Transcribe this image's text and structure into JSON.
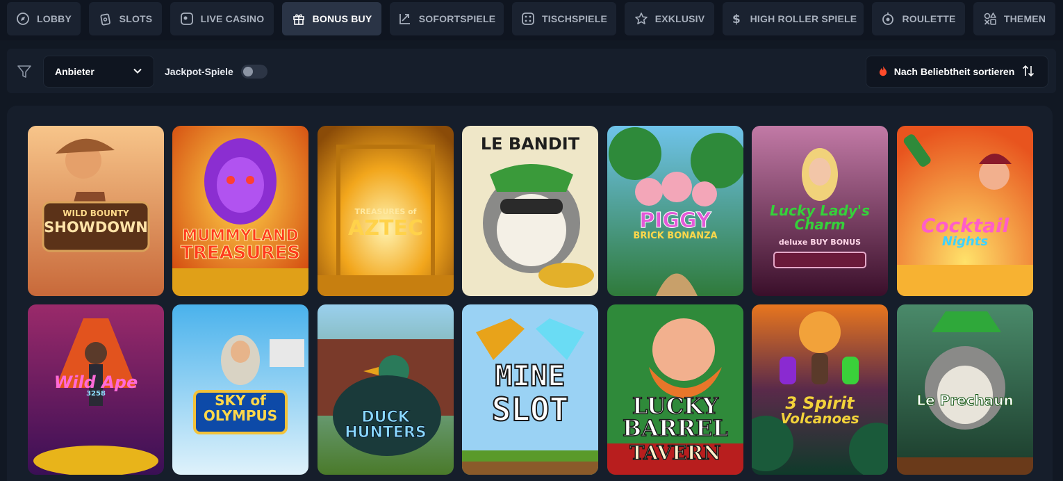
{
  "nav": {
    "items": [
      {
        "label": "LOBBY",
        "icon": "compass-icon",
        "active": false
      },
      {
        "label": "SLOTS",
        "icon": "slot-cards-icon",
        "active": false
      },
      {
        "label": "LIVE CASINO",
        "icon": "live-screen-icon",
        "active": false
      },
      {
        "label": "BONUS BUY",
        "icon": "gift-icon",
        "active": true
      },
      {
        "label": "SOFORTSPIELE",
        "icon": "chart-arrow-icon",
        "active": false
      },
      {
        "label": "TISCHSPIELE",
        "icon": "dice-icon",
        "active": false
      },
      {
        "label": "EXKLUSIV",
        "icon": "star-icon",
        "active": false
      },
      {
        "label": "HIGH ROLLER SPIELE",
        "icon": "dollar-icon",
        "active": false
      },
      {
        "label": "ROULETTE",
        "icon": "roulette-icon",
        "active": false
      },
      {
        "label": "THEMEN",
        "icon": "shapes-icon",
        "active": false
      }
    ]
  },
  "filters": {
    "provider_label": "Anbieter",
    "jackpot_label": "Jackpot-Spiele",
    "jackpot_enabled": false,
    "sort_label": "Nach Beliebtheit sortieren"
  },
  "colors": {
    "background": "#111823",
    "panel": "#161e2b",
    "nav_item": "#1a2230",
    "nav_active": "#2a3446",
    "accent_flame": "#ff4b2b"
  },
  "games": [
    {
      "title": "WILD BOUNTY",
      "subtitle": "SHOWDOWN"
    },
    {
      "title": "MUMMYLAND",
      "subtitle": "TREASURES"
    },
    {
      "title": "TREASURES of",
      "subtitle": "AZTEC"
    },
    {
      "title": "LE BANDIT",
      "subtitle": ""
    },
    {
      "title": "PIGGY",
      "subtitle": "BRICK BONANZA"
    },
    {
      "title": "Lucky Lady's Charm",
      "subtitle": "deluxe BUY BONUS"
    },
    {
      "title": "Cocktail",
      "subtitle": "Nights"
    },
    {
      "title": "Wild Ape",
      "subtitle": "3258"
    },
    {
      "title": "SKY of",
      "subtitle": "OLYMPUS"
    },
    {
      "title": "DUCK HUNTERS",
      "subtitle": ""
    },
    {
      "title": "MINE",
      "subtitle": "SLOT"
    },
    {
      "title": "LUCKY BARREL",
      "subtitle": "TAVERN"
    },
    {
      "title": "3 Spirit",
      "subtitle": "Volcanoes"
    },
    {
      "title": "Le Prechaun",
      "subtitle": ""
    }
  ]
}
